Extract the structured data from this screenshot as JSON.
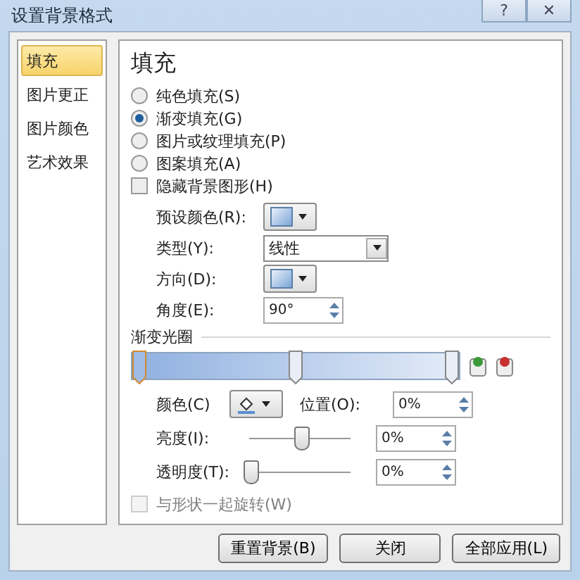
{
  "window": {
    "title": "设置背景格式",
    "help": "?",
    "close": "✕"
  },
  "sidebar": {
    "items": [
      {
        "label": "填充",
        "selected": true
      },
      {
        "label": "图片更正",
        "selected": false
      },
      {
        "label": "图片颜色",
        "selected": false
      },
      {
        "label": "艺术效果",
        "selected": false
      }
    ]
  },
  "heading": "填充",
  "fill_options": [
    {
      "label": "纯色填充(S)",
      "selected": false
    },
    {
      "label": "渐变填充(G)",
      "selected": true
    },
    {
      "label": "图片或纹理填充(P)",
      "selected": false
    },
    {
      "label": "图案填充(A)",
      "selected": false
    }
  ],
  "hide_background": {
    "label": "隐藏背景图形(H)",
    "checked": false
  },
  "preset": {
    "label": "预设颜色(R):"
  },
  "type": {
    "label": "类型(Y):",
    "value": "线性"
  },
  "direction": {
    "label": "方向(D):"
  },
  "angle": {
    "label": "角度(E):",
    "value": "90°"
  },
  "gradient_stops": {
    "label": "渐变光圈",
    "stops": [
      {
        "level": 0.02,
        "selected": true
      },
      {
        "level": 0.5,
        "selected": false
      },
      {
        "level": 0.98,
        "selected": false
      }
    ]
  },
  "color": {
    "label": "颜色(C)"
  },
  "position": {
    "label": "位置(O):",
    "value": "0%"
  },
  "brightness": {
    "label": "亮度(I):",
    "level": 0.5,
    "value": "0%"
  },
  "transparency": {
    "label": "透明度(T):",
    "level": 0,
    "value": "0%"
  },
  "rotate_with_shape": {
    "label": "与形状一起旋转(W)",
    "checked": false,
    "disabled": true
  },
  "buttons": [
    "重置背景(B)",
    "关闭",
    "全部应用(L)"
  ]
}
